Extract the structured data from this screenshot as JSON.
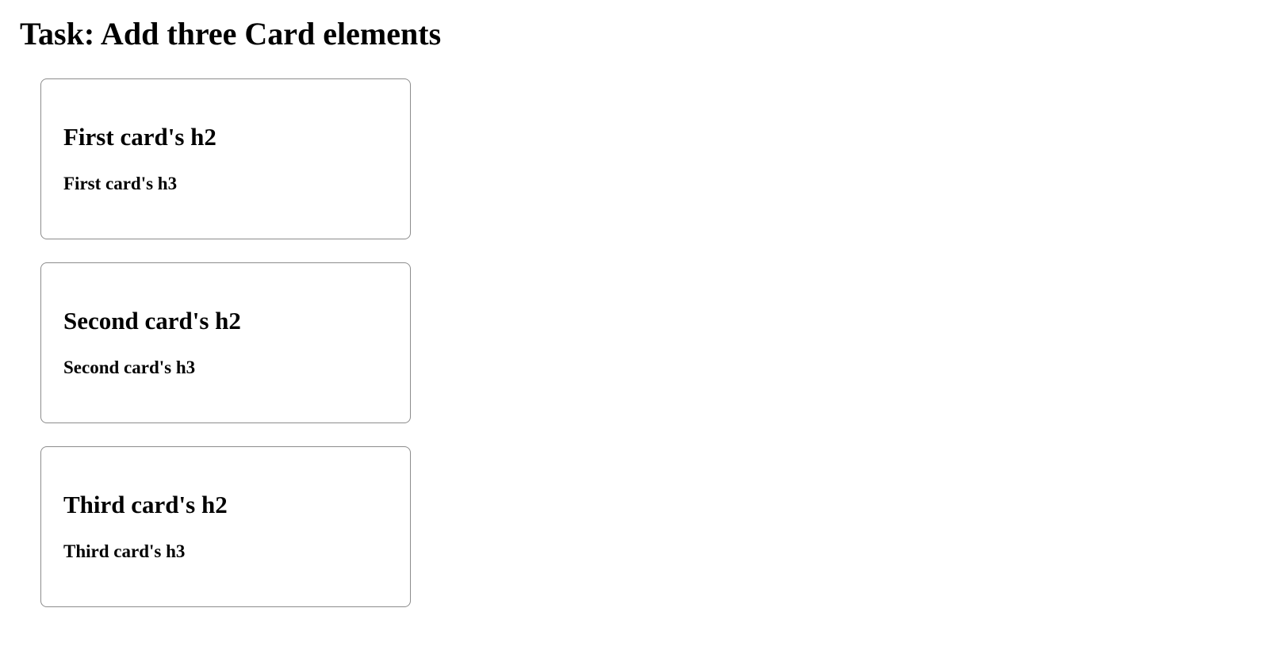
{
  "page": {
    "title": "Task: Add three Card elements"
  },
  "cards": [
    {
      "h2": "First card's h2",
      "h3": "First card's h3"
    },
    {
      "h2": "Second card's h2",
      "h3": "Second card's h3"
    },
    {
      "h2": "Third card's h2",
      "h3": "Third card's h3"
    }
  ],
  "colors": {
    "background": "#ffffff",
    "text": "#000000",
    "card_border": "#8c8c8c"
  }
}
